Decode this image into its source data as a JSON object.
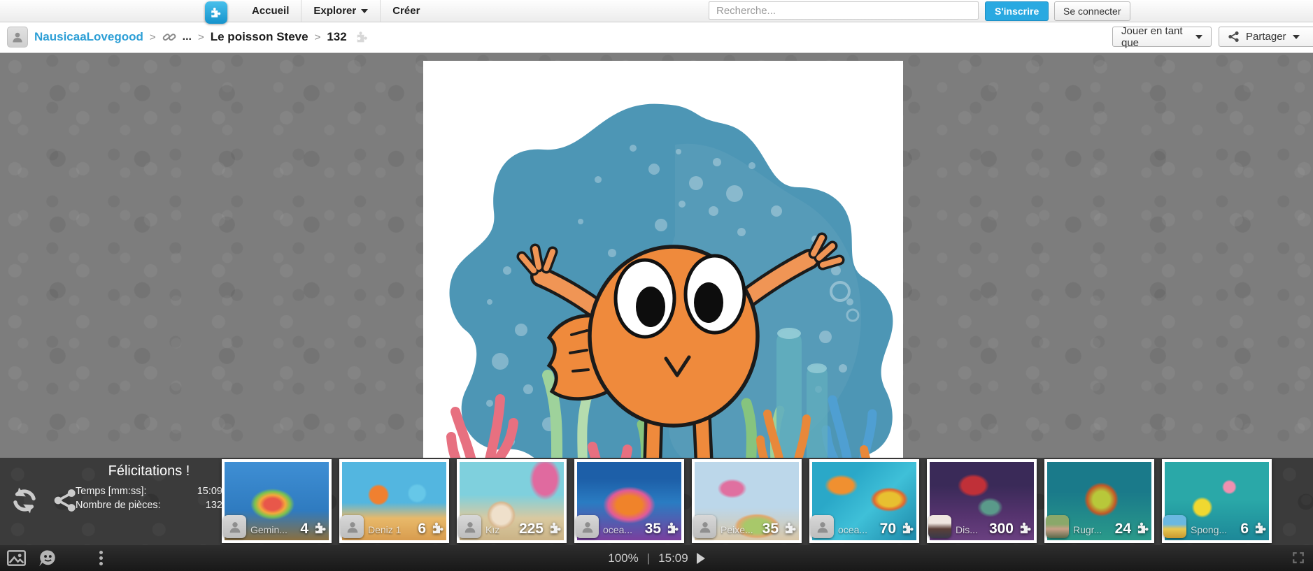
{
  "topnav": {
    "nav_items": [
      {
        "label": "Accueil"
      },
      {
        "label": "Explorer"
      },
      {
        "label": "Créer"
      }
    ],
    "search_placeholder": "Recherche...",
    "signup_label": "S'inscrire",
    "login_label": "Se connecter"
  },
  "breadcrumb": {
    "user": "NausicaaLovegood",
    "separator": ">",
    "ellipsis": "...",
    "puzzle_title": "Le poisson Steve",
    "piece_count": "132",
    "play_as_label": "Jouer en tant que",
    "share_label": "Partager"
  },
  "completion_panel": {
    "title": "Félicitations !",
    "time_label": "Temps [mm:ss]:",
    "time_value": "15:09",
    "pieces_label": "Nombre de pièces:",
    "pieces_value": "132"
  },
  "thumbnails": [
    {
      "label": "Gemin...",
      "count": "4"
    },
    {
      "label": "Deniz 1",
      "count": "6"
    },
    {
      "label": "Kız",
      "count": "225"
    },
    {
      "label": "ocea...",
      "count": "35"
    },
    {
      "label": "Peixe...",
      "count": "35"
    },
    {
      "label": "ocea...",
      "count": "70"
    },
    {
      "label": "Dis...",
      "count": "300"
    },
    {
      "label": "Rugr...",
      "count": "24"
    },
    {
      "label": "Spong...",
      "count": "6"
    }
  ],
  "bottom_toolbar": {
    "zoom_level": "100%",
    "separator": "|",
    "time": "15:09"
  },
  "icons": {
    "logo": "puzzle-piece",
    "breadcrumb_link": "chain-link",
    "breadcrumb_piece": "puzzle-piece",
    "panel_left": [
      "restart-circular-arrows",
      "share-nodes"
    ],
    "toolbar_left": [
      "image-preview",
      "ghost-preview",
      "edge-pieces-grid",
      "more-vertical-dots"
    ],
    "toolbar_right": "fullscreen-expand"
  },
  "colors": {
    "accent_blue": "#29a9e1",
    "link_blue": "#2d9fd6",
    "panel_bg": "#3b3b3b",
    "workspace_bg": "#7d7d7d"
  }
}
